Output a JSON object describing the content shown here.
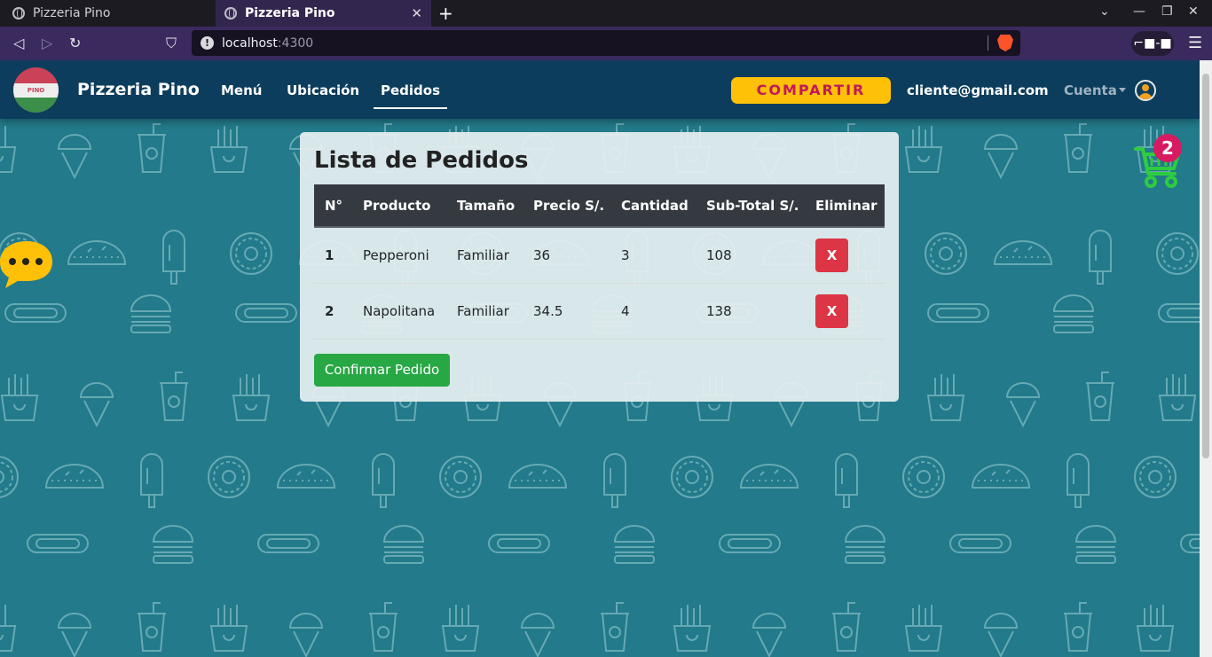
{
  "browser": {
    "tabs": [
      {
        "title": "Pizzeria Pino",
        "active": false
      },
      {
        "title": "Pizzeria Pino",
        "active": true
      }
    ],
    "url_host": "localhost",
    "url_port": ":4300"
  },
  "app": {
    "brand": "Pizzeria Pino",
    "logo_text": "PINO",
    "nav": [
      "Menú",
      "Ubicación",
      "Pedidos"
    ],
    "active_nav": "Pedidos",
    "share_label": "COMPARTIR",
    "user_email": "cliente@gmail.com",
    "account_label": "Cuenta",
    "cart_count": "2"
  },
  "orders": {
    "title": "Lista de Pedidos",
    "headers": [
      "N°",
      "Producto",
      "Tamaño",
      "Precio S/.",
      "Cantidad",
      "Sub-Total S/.",
      "Eliminar"
    ],
    "rows": [
      {
        "n": "1",
        "product": "Pepperoni",
        "size": "Familiar",
        "price": "36",
        "qty": "3",
        "subtotal": "108",
        "delete_label": "X"
      },
      {
        "n": "2",
        "product": "Napolitana",
        "size": "Familiar",
        "price": "34.5",
        "qty": "4",
        "subtotal": "138",
        "delete_label": "X"
      }
    ],
    "confirm_label": "Confirmar Pedido"
  },
  "colors": {
    "background": "#227a8a",
    "navbar": "#0c3d5c",
    "share_button": "#ffc107",
    "delete_button": "#dc3545",
    "confirm_button": "#28a745",
    "cart_badge": "#d81b60",
    "cart_icon": "#2ecc40"
  }
}
